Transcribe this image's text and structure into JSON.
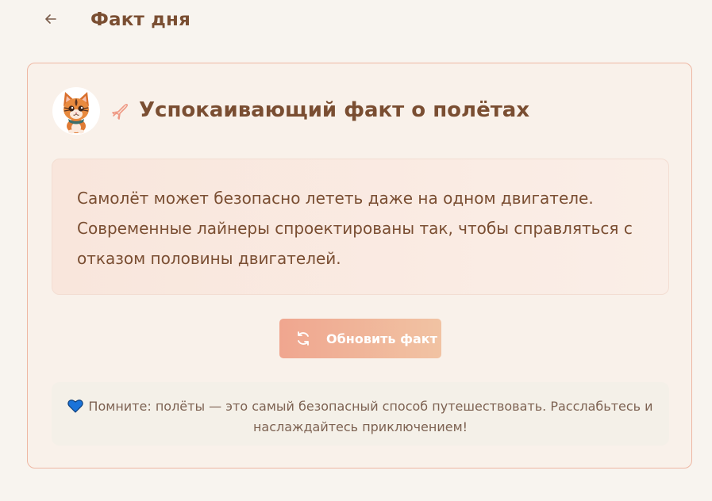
{
  "header": {
    "back_icon": "arrow-left-icon",
    "title": "Факт дня"
  },
  "card": {
    "avatar_icon": "cat-mascot-icon",
    "title_icon": "airplane-icon",
    "title": "Успокаивающий факт о полётах",
    "fact": "Самолёт может безопасно лететь даже на одном двигателе. Современные лайнеры спроектированы так, чтобы справляться с отказом половины двигателей.",
    "refresh_button": {
      "icon": "refresh-icon",
      "label": "Обновить факт"
    },
    "note": {
      "icon": "blue-heart-icon",
      "text": "Помните: полёты — это самый безопасный способ путешествовать. Расслабьтесь и наслаждайтесь приключением!"
    }
  },
  "colors": {
    "background": "#f8f4ef",
    "card_border": "#eeb7a3",
    "title": "#7a4e32",
    "button_start": "#f0a68f",
    "button_end": "#f1c3a3",
    "heart": "#1a73d9"
  }
}
